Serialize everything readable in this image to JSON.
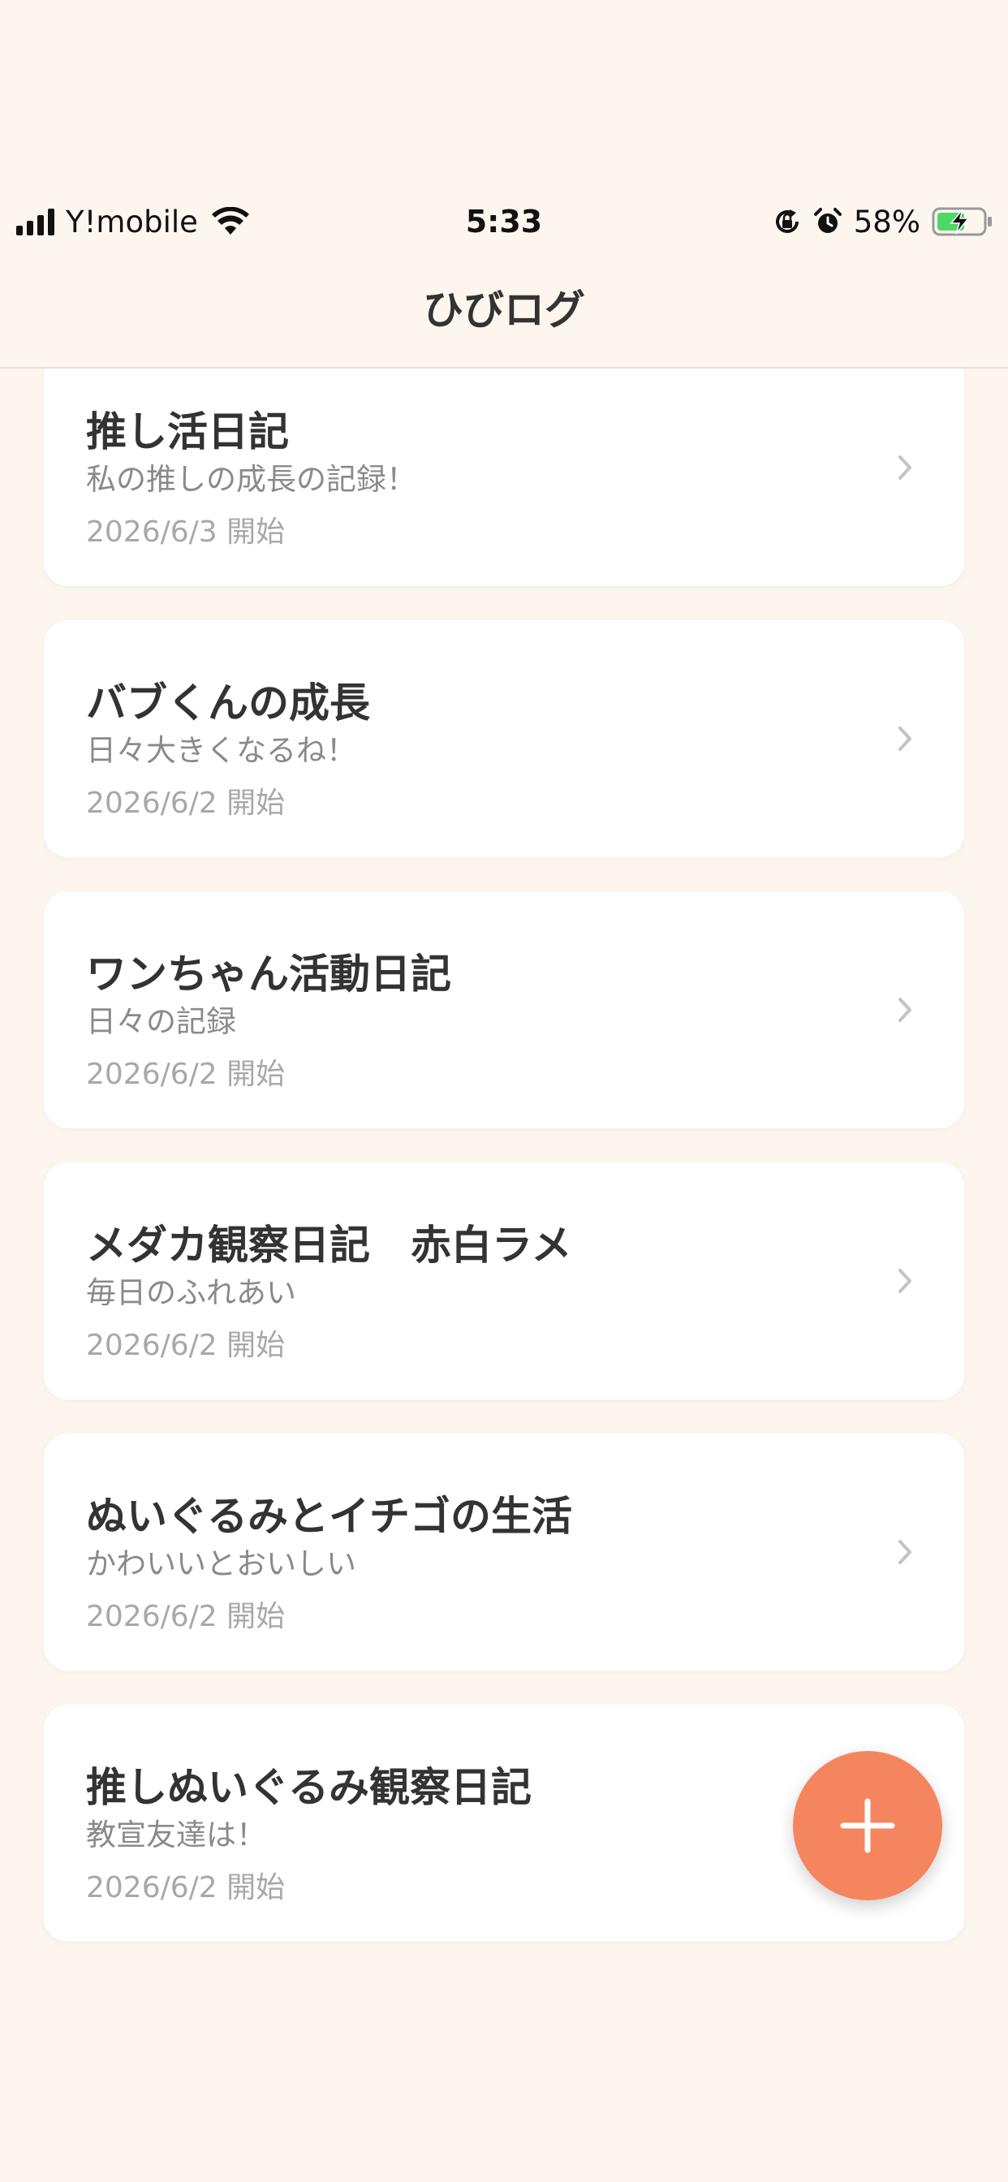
{
  "status_bar": {
    "carrier": "Y!mobile",
    "time": "5:33",
    "battery_percent": "58%",
    "icons": [
      "signal-icon",
      "wifi-icon",
      "orientation-lock-icon",
      "alarm-icon",
      "battery-charging-icon"
    ]
  },
  "header": {
    "title": "ひびログ"
  },
  "diaries": [
    {
      "title": "推し活日記",
      "description": "私の推しの成長の記録！",
      "start_date": "2026/6/3 開始"
    },
    {
      "title": "バブくんの成長",
      "description": "日々大きくなるね！",
      "start_date": "2026/6/2 開始"
    },
    {
      "title": "ワンちゃん活動日記",
      "description": "日々の記録",
      "start_date": "2026/6/2 開始"
    },
    {
      "title": "メダカ観察日記　赤白ラメ",
      "description": "毎日のふれあい",
      "start_date": "2026/6/2 開始"
    },
    {
      "title": "ぬいぐるみとイチゴの生活",
      "description": "かわいいとおいしい",
      "start_date": "2026/6/2 開始"
    },
    {
      "title": "推しぬいぐるみ観察日記",
      "description": "教宣友達は！",
      "start_date": "2026/6/2 開始"
    }
  ],
  "fab": {
    "icon": "plus-icon",
    "color": "#F5855F"
  },
  "colors": {
    "background": "#FDF6EF",
    "card": "#FFFFFF",
    "title_text": "#333333",
    "secondary_text": "#8A8A8A",
    "date_text": "#A8A8A8",
    "accent": "#F5855F",
    "battery_charging": "#4CD964"
  }
}
